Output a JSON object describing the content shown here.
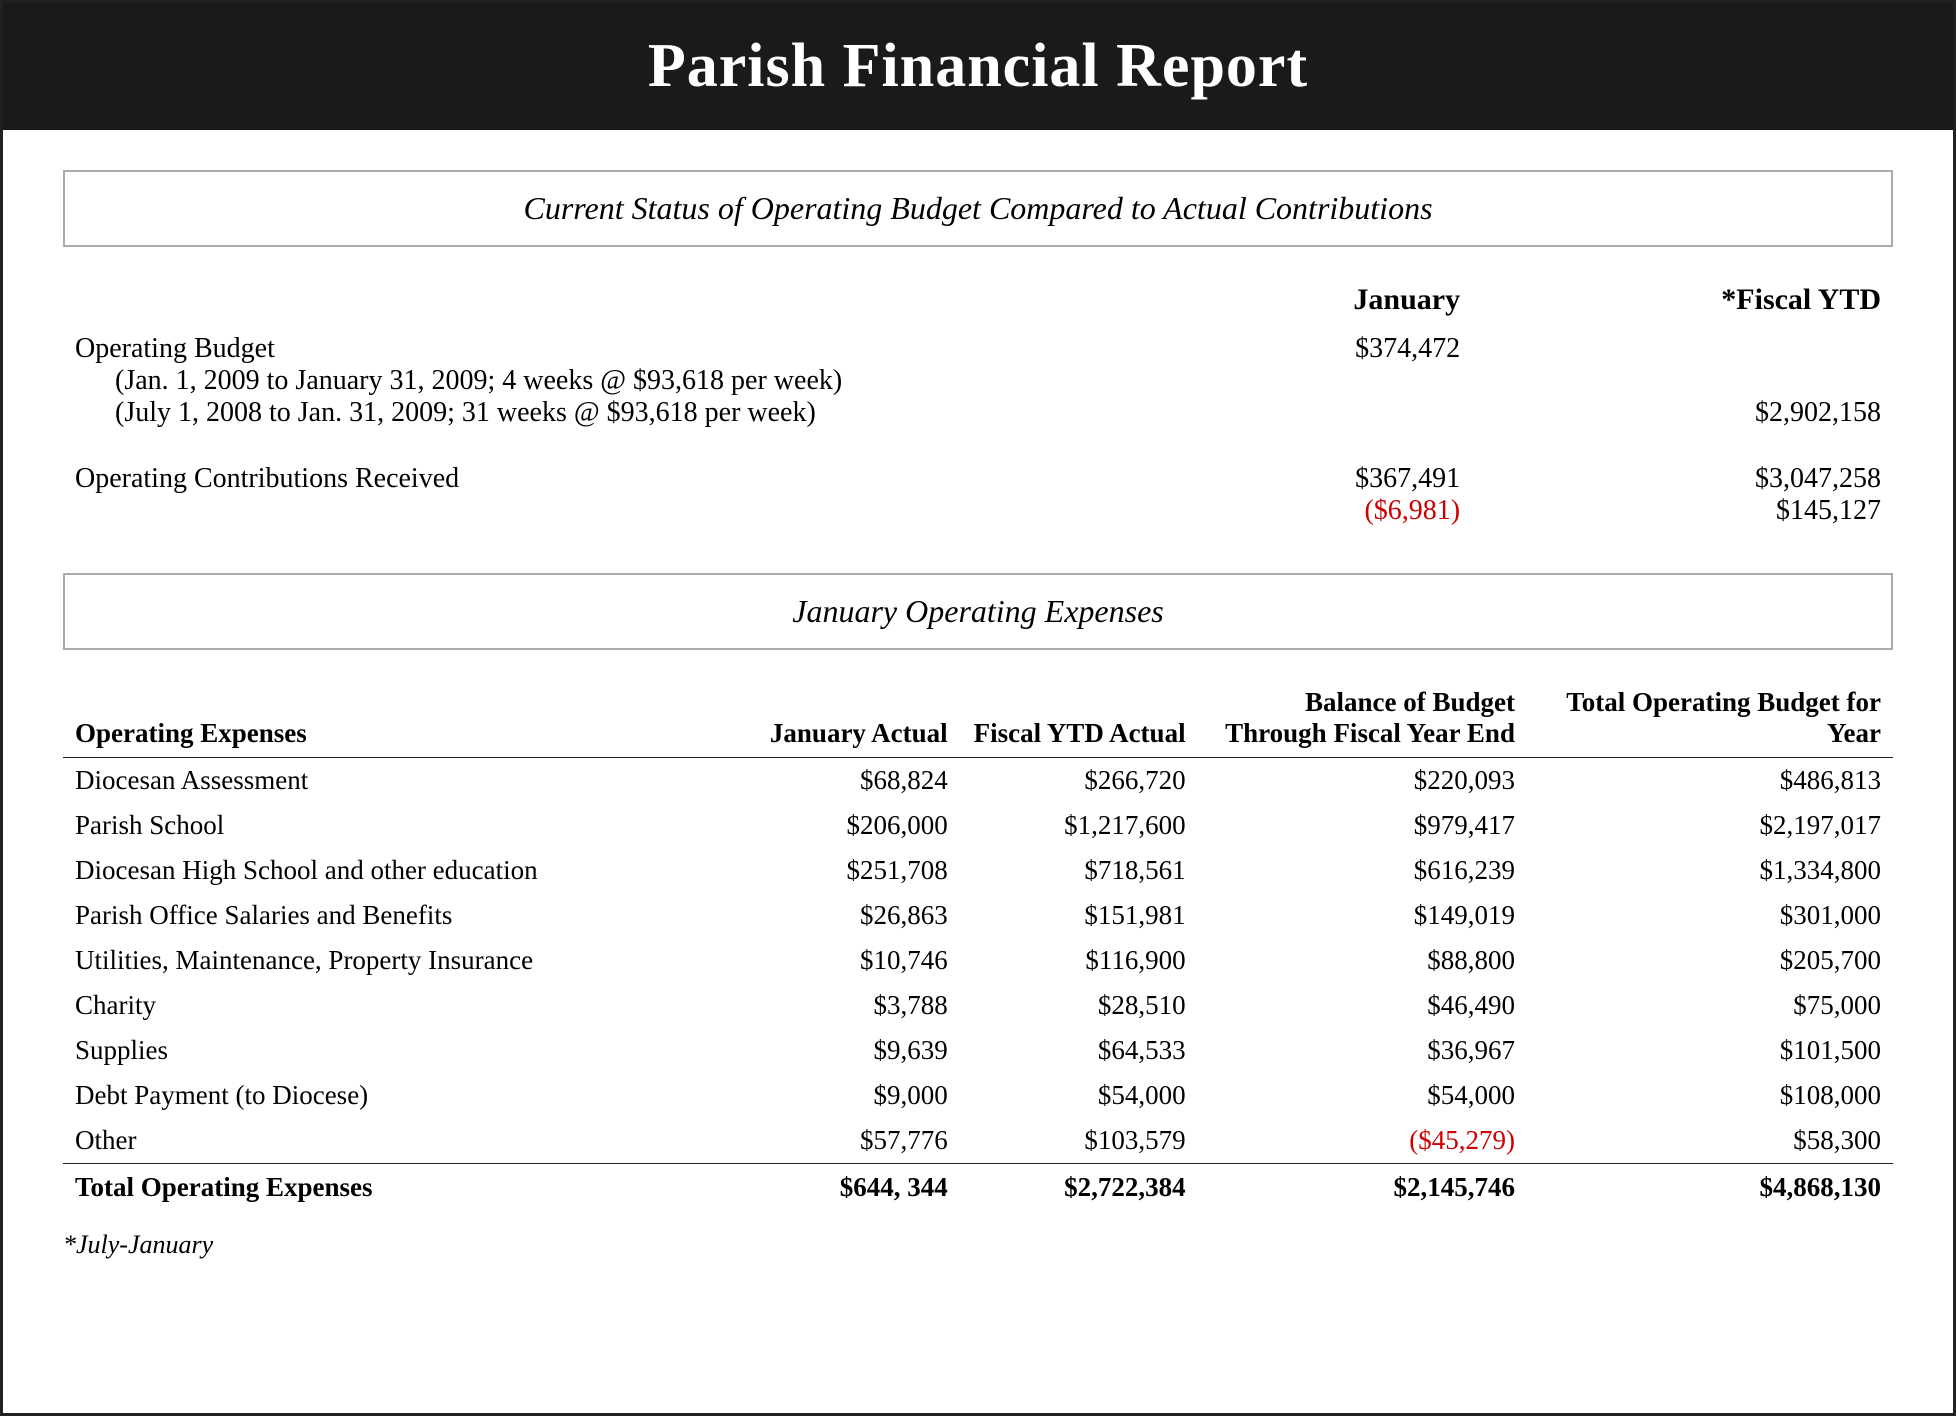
{
  "header": {
    "title": "Parish Financial Report"
  },
  "section1": {
    "title": "Current Status of Operating Budget Compared to Actual Contributions",
    "col_jan": "January",
    "col_ytd": "*Fiscal YTD",
    "rows": [
      {
        "label": "Operating Budget",
        "label_sub1": "(Jan. 1, 2009 to January 31, 2009; 4 weeks @ $93,618 per week)",
        "label_sub2": "(July 1, 2008 to Jan. 31, 2009; 31 weeks @ $93,618 per week)",
        "jan": "$374,472",
        "ytd": "",
        "jan2": "",
        "ytd2": "$2,902,158"
      },
      {
        "label": "Operating Contributions Received",
        "jan": "$367,491",
        "jan_diff": "($6,981)",
        "ytd": "$3,047,258",
        "ytd_diff": "$145,127"
      }
    ]
  },
  "section2": {
    "title": "January Operating Expenses",
    "col_name": "Operating Expenses",
    "col_jan_actual": "January Actual",
    "col_ytd_actual": "Fiscal YTD Actual",
    "col_balance": "Balance of Budget Through Fiscal Year End",
    "col_total_budget": "Total Operating Budget for Year",
    "rows": [
      {
        "name": "Diocesan Assessment",
        "jan_actual": "$68,824",
        "ytd_actual": "$266,720",
        "balance": "$220,093",
        "total_budget": "$486,813"
      },
      {
        "name": "Parish School",
        "jan_actual": "$206,000",
        "ytd_actual": "$1,217,600",
        "balance": "$979,417",
        "total_budget": "$2,197,017"
      },
      {
        "name": "Diocesan High School and other education",
        "jan_actual": "$251,708",
        "ytd_actual": "$718,561",
        "balance": "$616,239",
        "total_budget": "$1,334,800"
      },
      {
        "name": "Parish Office Salaries and Benefits",
        "jan_actual": "$26,863",
        "ytd_actual": "$151,981",
        "balance": "$149,019",
        "total_budget": "$301,000"
      },
      {
        "name": "Utilities, Maintenance, Property Insurance",
        "jan_actual": "$10,746",
        "ytd_actual": "$116,900",
        "balance": "$88,800",
        "total_budget": "$205,700"
      },
      {
        "name": "Charity",
        "jan_actual": "$3,788",
        "ytd_actual": "$28,510",
        "balance": "$46,490",
        "total_budget": "$75,000"
      },
      {
        "name": "Supplies",
        "jan_actual": "$9,639",
        "ytd_actual": "$64,533",
        "balance": "$36,967",
        "total_budget": "$101,500"
      },
      {
        "name": "Debt Payment (to Diocese)",
        "jan_actual": "$9,000",
        "ytd_actual": "$54,000",
        "balance": "$54,000",
        "total_budget": "$108,000"
      },
      {
        "name": "Other",
        "jan_actual": "$57,776",
        "ytd_actual": "$103,579",
        "balance": "($45,279)",
        "balance_red": true,
        "total_budget": "$58,300"
      }
    ],
    "total_row": {
      "name": "Total Operating Expenses",
      "jan_actual": "$644, 344",
      "ytd_actual": "$2,722,384",
      "balance": "$2,145,746",
      "total_budget": "$4,868,130"
    },
    "footnote": "*July-January"
  }
}
